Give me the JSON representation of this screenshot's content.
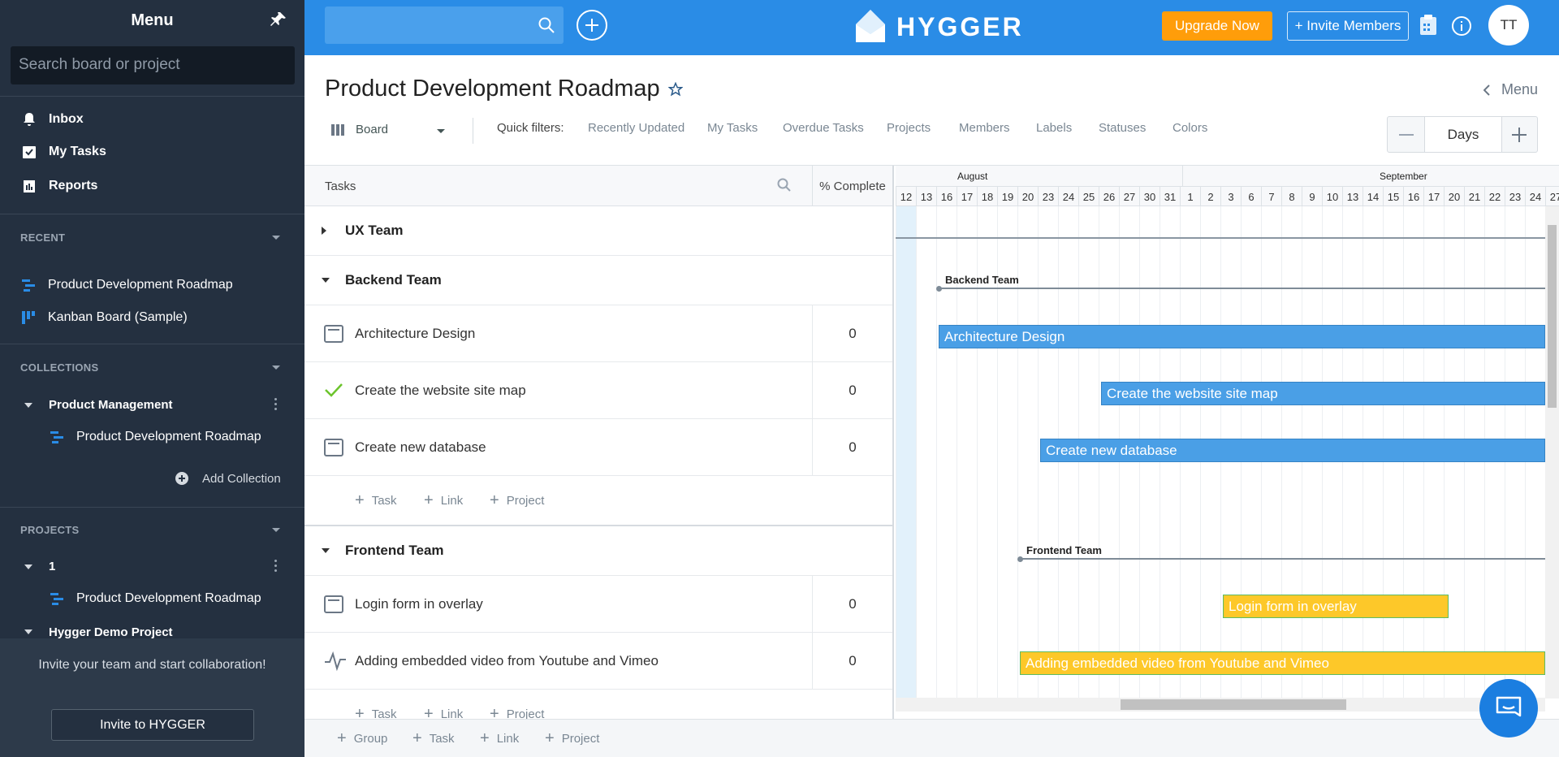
{
  "sidebar": {
    "title": "Menu",
    "search_placeholder": "Search board or project",
    "nav": [
      {
        "label": "Inbox",
        "icon": "bell-icon"
      },
      {
        "label": "My Tasks",
        "icon": "checklist-icon"
      },
      {
        "label": "Reports",
        "icon": "report-icon"
      }
    ],
    "recent_title": "RECENT",
    "recent": [
      {
        "label": "Product Development Roadmap",
        "icon": "roadmap-icon"
      },
      {
        "label": "Kanban Board (Sample)",
        "icon": "kanban-icon"
      }
    ],
    "collections_title": "COLLECTIONS",
    "collection": {
      "label": "Product Management",
      "item": "Product Development Roadmap"
    },
    "add_collection": "Add Collection",
    "projects_title": "PROJECTS",
    "project1": {
      "label": "1",
      "item": "Product Development Roadmap"
    },
    "project2": {
      "label": "Hygger Demo Project"
    },
    "footer_text": "Invite your team and start collaboration!",
    "footer_button": "Invite to HYGGER"
  },
  "topbar": {
    "logo": "HYGGER",
    "upgrade": "Upgrade Now",
    "invite": "+ Invite Members",
    "avatar": "TT",
    "accent": "#2a8ce6"
  },
  "page": {
    "title": "Product Development Roadmap",
    "menu": "Menu",
    "view": "Board",
    "quick_filters_label": "Quick filters:",
    "quick_filters": [
      "Recently Updated",
      "My Tasks",
      "Overdue Tasks",
      "Projects",
      "Members",
      "Labels",
      "Statuses",
      "Colors"
    ],
    "zoom": "Days"
  },
  "grid": {
    "col_tasks": "Tasks",
    "col_complete": "% Complete",
    "groups": [
      {
        "label": "UX Team"
      },
      {
        "label": "Backend Team"
      },
      {
        "label": "Frontend Team"
      }
    ],
    "backend_tasks": [
      {
        "label": "Architecture Design",
        "pct": "0",
        "icon": "card-icon"
      },
      {
        "label": "Create the website site map",
        "pct": "0",
        "icon": "check-icon"
      },
      {
        "label": "Create new database",
        "pct": "0",
        "icon": "card-icon"
      }
    ],
    "frontend_tasks": [
      {
        "label": "Login form in overlay",
        "pct": "0",
        "icon": "card-icon"
      },
      {
        "label": "Adding embedded video from Youtube and Vimeo",
        "pct": "0",
        "icon": "pulse-icon"
      }
    ],
    "add_links": {
      "task": "Task",
      "link": "Link",
      "project": "Project",
      "group": "Group"
    }
  },
  "gantt": {
    "months": [
      "August",
      "September"
    ],
    "days": [
      "12",
      "13",
      "16",
      "17",
      "18",
      "19",
      "20",
      "23",
      "24",
      "25",
      "26",
      "27",
      "30",
      "31",
      "1",
      "2",
      "3",
      "6",
      "7",
      "8",
      "9",
      "10",
      "13",
      "14",
      "15",
      "16",
      "17",
      "20",
      "21",
      "22",
      "23",
      "24",
      "27"
    ],
    "bars": {
      "backend_group": "Backend Team",
      "frontend_group": "Frontend Team",
      "arch": "Architecture Design",
      "sitemap": "Create the website site map",
      "db": "Create new database",
      "login": "Login form in overlay",
      "video": "Adding embedded video from Youtube and Vimeo"
    },
    "colors": {
      "blue": "#4a9fe6",
      "yellow": "#fdc829"
    }
  }
}
